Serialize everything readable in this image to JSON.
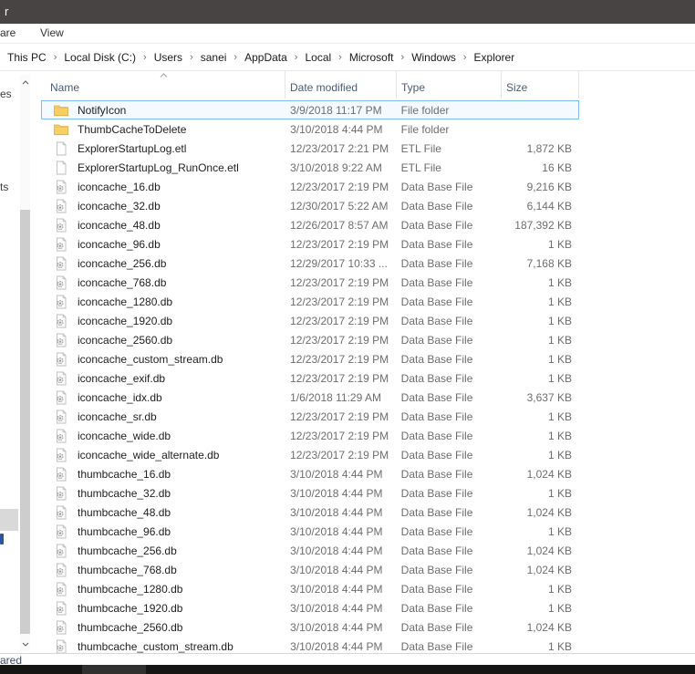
{
  "window": {
    "title_fragment": "r"
  },
  "ribbon": {
    "share_tab_fragment": "are",
    "view_tab": "View"
  },
  "breadcrumb": {
    "separator": "›",
    "items": [
      "This PC",
      "Local Disk (C:)",
      "Users",
      "sanei",
      "AppData",
      "Local",
      "Microsoft",
      "Windows",
      "Explorer"
    ]
  },
  "sidebar": {
    "fragments": [
      "es",
      "ts"
    ]
  },
  "columns": {
    "name": "Name",
    "date": "Date modified",
    "type": "Type",
    "size": "Size"
  },
  "files": [
    {
      "name": "NotifyIcon",
      "date": "3/9/2018 11:17 PM",
      "type": "File folder",
      "size": "",
      "icon": "folder",
      "selected": true
    },
    {
      "name": "ThumbCacheToDelete",
      "date": "3/10/2018 4:44 PM",
      "type": "File folder",
      "size": "",
      "icon": "folder",
      "selected": false
    },
    {
      "name": "ExplorerStartupLog.etl",
      "date": "12/23/2017 2:21 PM",
      "type": "ETL File",
      "size": "1,872 KB",
      "icon": "file",
      "selected": false
    },
    {
      "name": "ExplorerStartupLog_RunOnce.etl",
      "date": "3/10/2018 9:22 AM",
      "type": "ETL File",
      "size": "16 KB",
      "icon": "file",
      "selected": false
    },
    {
      "name": "iconcache_16.db",
      "date": "12/23/2017 2:19 PM",
      "type": "Data Base File",
      "size": "9,216 KB",
      "icon": "db",
      "selected": false
    },
    {
      "name": "iconcache_32.db",
      "date": "12/30/2017 5:22 AM",
      "type": "Data Base File",
      "size": "6,144 KB",
      "icon": "db",
      "selected": false
    },
    {
      "name": "iconcache_48.db",
      "date": "12/26/2017 8:57 AM",
      "type": "Data Base File",
      "size": "187,392 KB",
      "icon": "db",
      "selected": false
    },
    {
      "name": "iconcache_96.db",
      "date": "12/23/2017 2:19 PM",
      "type": "Data Base File",
      "size": "1 KB",
      "icon": "db",
      "selected": false
    },
    {
      "name": "iconcache_256.db",
      "date": "12/29/2017 10:33 ...",
      "type": "Data Base File",
      "size": "7,168 KB",
      "icon": "db",
      "selected": false
    },
    {
      "name": "iconcache_768.db",
      "date": "12/23/2017 2:19 PM",
      "type": "Data Base File",
      "size": "1 KB",
      "icon": "db",
      "selected": false
    },
    {
      "name": "iconcache_1280.db",
      "date": "12/23/2017 2:19 PM",
      "type": "Data Base File",
      "size": "1 KB",
      "icon": "db",
      "selected": false
    },
    {
      "name": "iconcache_1920.db",
      "date": "12/23/2017 2:19 PM",
      "type": "Data Base File",
      "size": "1 KB",
      "icon": "db",
      "selected": false
    },
    {
      "name": "iconcache_2560.db",
      "date": "12/23/2017 2:19 PM",
      "type": "Data Base File",
      "size": "1 KB",
      "icon": "db",
      "selected": false
    },
    {
      "name": "iconcache_custom_stream.db",
      "date": "12/23/2017 2:19 PM",
      "type": "Data Base File",
      "size": "1 KB",
      "icon": "db",
      "selected": false
    },
    {
      "name": "iconcache_exif.db",
      "date": "12/23/2017 2:19 PM",
      "type": "Data Base File",
      "size": "1 KB",
      "icon": "db",
      "selected": false
    },
    {
      "name": "iconcache_idx.db",
      "date": "1/6/2018 11:29 AM",
      "type": "Data Base File",
      "size": "3,637 KB",
      "icon": "db",
      "selected": false
    },
    {
      "name": "iconcache_sr.db",
      "date": "12/23/2017 2:19 PM",
      "type": "Data Base File",
      "size": "1 KB",
      "icon": "db",
      "selected": false
    },
    {
      "name": "iconcache_wide.db",
      "date": "12/23/2017 2:19 PM",
      "type": "Data Base File",
      "size": "1 KB",
      "icon": "db",
      "selected": false
    },
    {
      "name": "iconcache_wide_alternate.db",
      "date": "12/23/2017 2:19 PM",
      "type": "Data Base File",
      "size": "1 KB",
      "icon": "db",
      "selected": false
    },
    {
      "name": "thumbcache_16.db",
      "date": "3/10/2018 4:44 PM",
      "type": "Data Base File",
      "size": "1,024 KB",
      "icon": "db",
      "selected": false
    },
    {
      "name": "thumbcache_32.db",
      "date": "3/10/2018 4:44 PM",
      "type": "Data Base File",
      "size": "1 KB",
      "icon": "db",
      "selected": false
    },
    {
      "name": "thumbcache_48.db",
      "date": "3/10/2018 4:44 PM",
      "type": "Data Base File",
      "size": "1,024 KB",
      "icon": "db",
      "selected": false
    },
    {
      "name": "thumbcache_96.db",
      "date": "3/10/2018 4:44 PM",
      "type": "Data Base File",
      "size": "1 KB",
      "icon": "db",
      "selected": false
    },
    {
      "name": "thumbcache_256.db",
      "date": "3/10/2018 4:44 PM",
      "type": "Data Base File",
      "size": "1,024 KB",
      "icon": "db",
      "selected": false
    },
    {
      "name": "thumbcache_768.db",
      "date": "3/10/2018 4:44 PM",
      "type": "Data Base File",
      "size": "1,024 KB",
      "icon": "db",
      "selected": false
    },
    {
      "name": "thumbcache_1280.db",
      "date": "3/10/2018 4:44 PM",
      "type": "Data Base File",
      "size": "1 KB",
      "icon": "db",
      "selected": false
    },
    {
      "name": "thumbcache_1920.db",
      "date": "3/10/2018 4:44 PM",
      "type": "Data Base File",
      "size": "1 KB",
      "icon": "db",
      "selected": false
    },
    {
      "name": "thumbcache_2560.db",
      "date": "3/10/2018 4:44 PM",
      "type": "Data Base File",
      "size": "1,024 KB",
      "icon": "db",
      "selected": false
    },
    {
      "name": "thumbcache_custom_stream.db",
      "date": "3/10/2018 4:44 PM",
      "type": "Data Base File",
      "size": "1 KB",
      "icon": "db",
      "selected": false
    }
  ],
  "status": {
    "text_fragment": "ared"
  },
  "colors": {
    "titlebar": "#474443",
    "selection_border": "#7cc0e8",
    "selection_fill": "#f4fafe",
    "folder": "#f6cf65",
    "header_text": "#4a5c78",
    "secondary_text": "#6d6d6d",
    "taskbar": "#161514"
  }
}
